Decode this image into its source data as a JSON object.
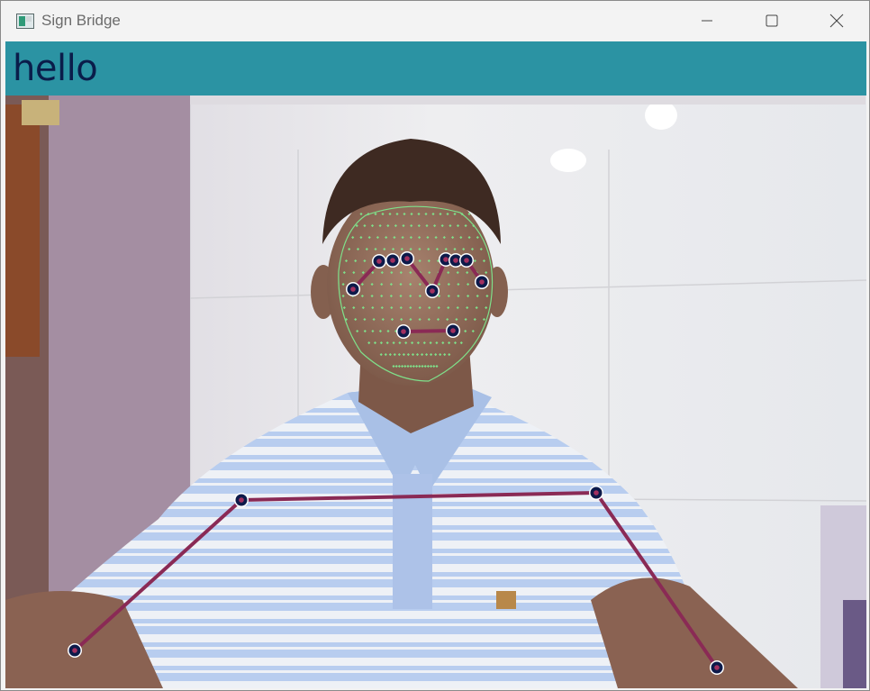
{
  "window": {
    "title": "Sign Bridge",
    "icon": "app-window-icon",
    "controls": [
      "minimize-icon",
      "maximize-icon",
      "close-icon"
    ]
  },
  "banner": {
    "text": "hello",
    "background_color": "#2b93a3",
    "text_color": "#0a1d4a"
  },
  "overlay": {
    "pose_line_color": "#8a2a55",
    "landmark_color": "#0d1a4a",
    "face_mesh_color": "#7fe08a"
  }
}
